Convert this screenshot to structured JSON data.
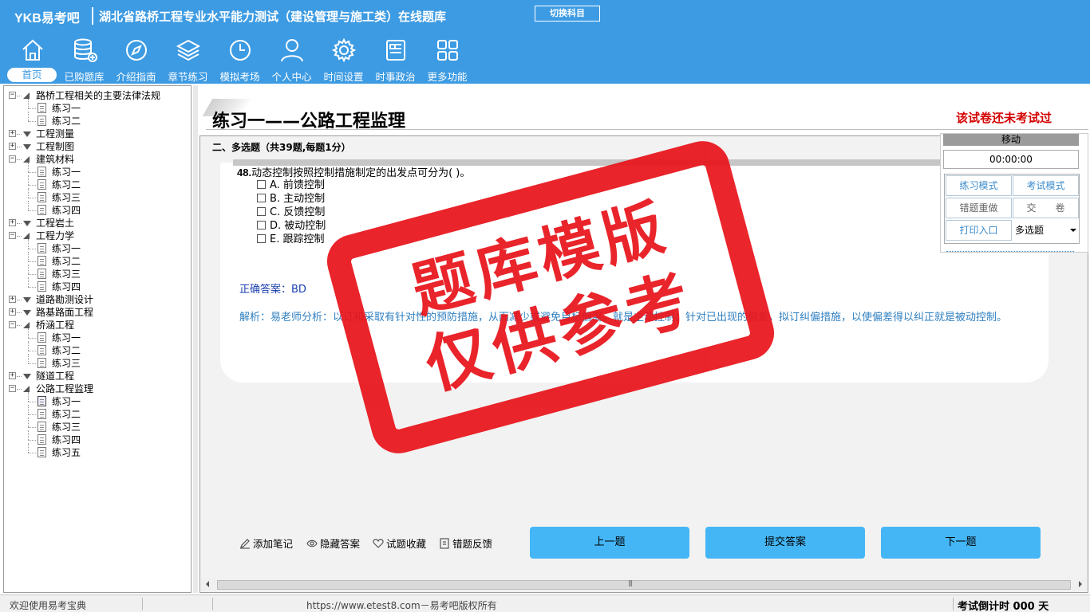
{
  "header": {
    "brand": "YKB易考吧",
    "title": "湖北省路桥工程专业水平能力测试（建设管理与施工类）在线题库",
    "switch_label": "切换科目",
    "nav": [
      {
        "label": "首页",
        "icon": "home-icon"
      },
      {
        "label": "已购题库",
        "icon": "database-icon"
      },
      {
        "label": "介绍指南",
        "icon": "compass-icon"
      },
      {
        "label": "章节练习",
        "icon": "layers-icon"
      },
      {
        "label": "模拟考场",
        "icon": "clock-icon"
      },
      {
        "label": "个人中心",
        "icon": "user-icon"
      },
      {
        "label": "时间设置",
        "icon": "gear-icon"
      },
      {
        "label": "时事政治",
        "icon": "news-icon"
      },
      {
        "label": "更多功能",
        "icon": "grid-icon"
      }
    ]
  },
  "tree": {
    "nodes": [
      {
        "label": "路桥工程相关的主要法律法规",
        "level": 0,
        "expanded": true
      },
      {
        "label": "练习一",
        "level": 1
      },
      {
        "label": "练习二",
        "level": 1
      },
      {
        "label": "工程测量",
        "level": 0,
        "expanded": false
      },
      {
        "label": "工程制图",
        "level": 0,
        "expanded": false
      },
      {
        "label": "建筑材料",
        "level": 0,
        "expanded": true
      },
      {
        "label": "练习一",
        "level": 1
      },
      {
        "label": "练习二",
        "level": 1
      },
      {
        "label": "练习三",
        "level": 1
      },
      {
        "label": "练习四",
        "level": 1
      },
      {
        "label": "工程岩土",
        "level": 0,
        "expanded": false
      },
      {
        "label": "工程力学",
        "level": 0,
        "expanded": true
      },
      {
        "label": "练习一",
        "level": 1
      },
      {
        "label": "练习二",
        "level": 1
      },
      {
        "label": "练习三",
        "level": 1
      },
      {
        "label": "练习四",
        "level": 1
      },
      {
        "label": "道路勘测设计",
        "level": 0,
        "expanded": false
      },
      {
        "label": "路基路面工程",
        "level": 0,
        "expanded": false
      },
      {
        "label": "桥涵工程",
        "level": 0,
        "expanded": true
      },
      {
        "label": "练习一",
        "level": 1
      },
      {
        "label": "练习二",
        "level": 1
      },
      {
        "label": "练习三",
        "level": 1
      },
      {
        "label": "隧道工程",
        "level": 0,
        "expanded": false
      },
      {
        "label": "公路工程监理",
        "level": 0,
        "expanded": true
      },
      {
        "label": "练习一",
        "level": 1,
        "selected": true
      },
      {
        "label": "练习二",
        "level": 1
      },
      {
        "label": "练习三",
        "level": 1
      },
      {
        "label": "练习四",
        "level": 1
      },
      {
        "label": "练习五",
        "level": 1
      }
    ]
  },
  "exam": {
    "title": "练习一——公路工程监理",
    "status": "该试卷还未考试过",
    "section": "二、多选题（共39题,每题1分）",
    "question": {
      "number": "48.",
      "text": "动态控制按照控制措施制定的出发点可分为( )。",
      "options": [
        "A. 前馈控制",
        "B. 主动控制",
        "C. 反馈控制",
        "D. 被动控制",
        "E. 跟踪控制"
      ]
    },
    "answer": "正确答案：BD",
    "analysis": "解析：易老师分析：以订和采取有针对性的预防措施，从而减少或避免目标偏离，就是主动控制；针对已出现的偏差，拟订纠偏措施，以使偏差得以纠正就是被动控制。"
  },
  "watermark": {
    "line1": "题库模版",
    "line2": "仅供参考"
  },
  "actions": {
    "add_note": "添加笔记",
    "hide_answer": "隐藏答案",
    "favorite": "试题收藏",
    "report": "错题反馈",
    "prev": "上一题",
    "submit": "提交答案",
    "next": "下一题"
  },
  "control_panel": {
    "move": "移动",
    "timer": "00:00:00",
    "practice_mode": "练习模式",
    "exam_mode": "考试模式",
    "redo_wrong": "错题重做",
    "hand_in": "交　　卷",
    "print": "打印入口",
    "type_select": "多选题"
  },
  "statusbar": {
    "welcome": "欢迎使用易考宝典",
    "copyright": "https://www.etest8.com－易考吧版权所有",
    "countdown": "考试倒计时 000 天"
  },
  "colors": {
    "header_bg": "#3d9be3",
    "button_bg": "#44b6f5",
    "status_red": "#d40000",
    "stamp_red": "#e8141b",
    "answer_blue": "#1b3fb0",
    "analysis_blue": "#2f7fc0"
  }
}
